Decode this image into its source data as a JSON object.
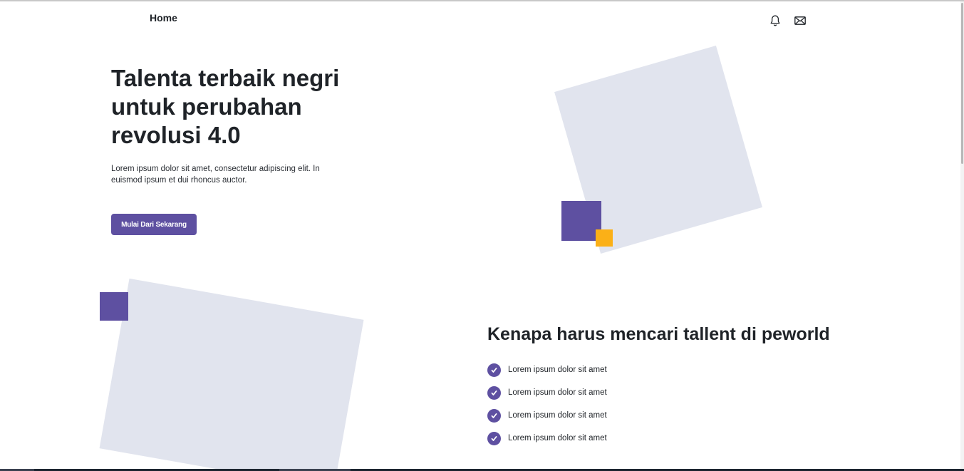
{
  "nav": {
    "home_label": "Home",
    "icons": [
      "bell-icon",
      "mail-icon"
    ]
  },
  "hero": {
    "title": "Talenta terbaik negri\nuntuk perubahan\nrevolusi 4.0",
    "description": "Lorem ipsum dolor sit amet, consectetur adipiscing elit. In euismod ipsum et dui rhoncus auctor.",
    "cta_label": "Mulai Dari Sekarang"
  },
  "why": {
    "title": "Kenapa harus mencari tallent di peworld",
    "items": [
      "Lorem ipsum dolor sit amet",
      "Lorem ipsum dolor sit amet",
      "Lorem ipsum dolor sit amet",
      "Lorem ipsum dolor sit amet"
    ]
  },
  "colors": {
    "primary": "#5e50a1",
    "accent": "#fbb017",
    "placeholder": "#e1e4ee",
    "text": "#1f2328"
  }
}
